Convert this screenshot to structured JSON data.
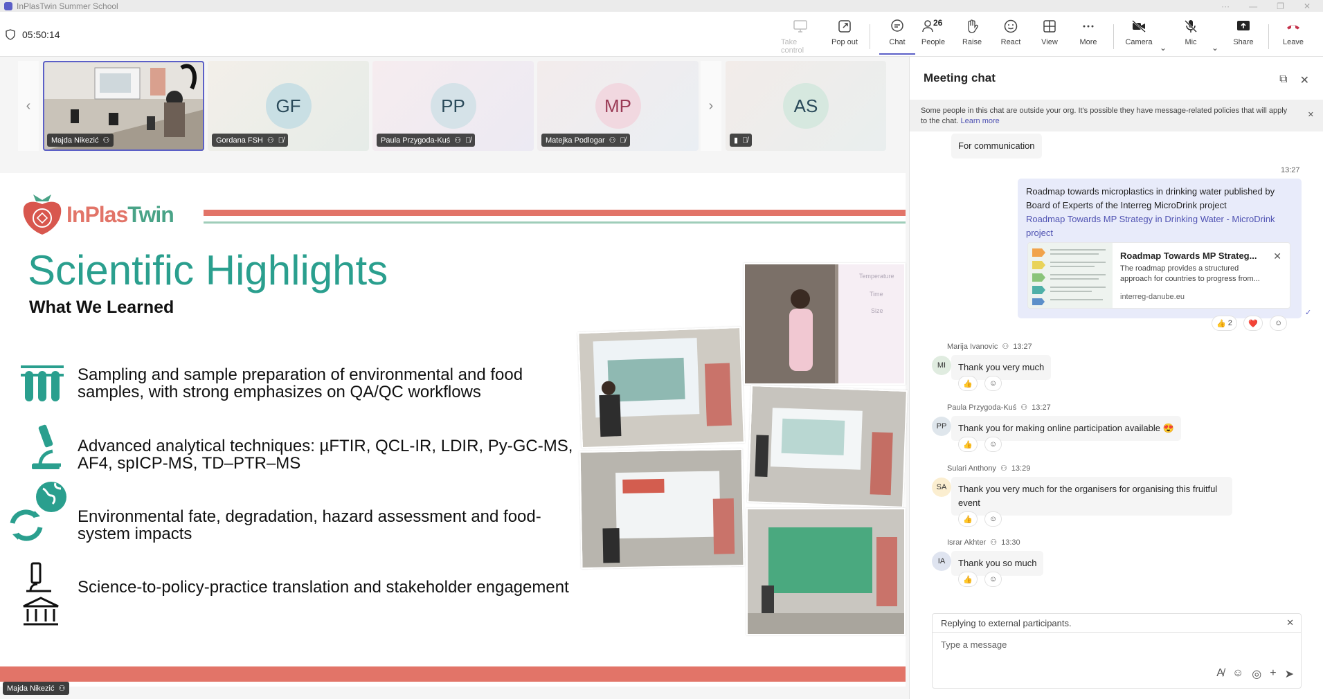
{
  "window": {
    "title": "InPlasTwin Summer School"
  },
  "toolbar": {
    "timer": "05:50:14",
    "take_control": "Take control",
    "pop_out": "Pop out",
    "chat": "Chat",
    "people": "People",
    "people_count": "26",
    "raise": "Raise",
    "react": "React",
    "view": "View",
    "more": "More",
    "camera": "Camera",
    "mic": "Mic",
    "share": "Share",
    "leave": "Leave"
  },
  "participants": [
    {
      "name": "Majda Nikezić",
      "initials": ""
    },
    {
      "name": "Gordana FSH",
      "initials": "GF"
    },
    {
      "name": "Paula Przygoda-Kuś",
      "initials": "PP"
    },
    {
      "name": "Matejka Podlogar",
      "initials": "MP"
    },
    {
      "name": "",
      "initials": "AS"
    }
  ],
  "slide": {
    "logo_a": "InPlas",
    "logo_b": "Twin",
    "title": "Scientific Highlights",
    "subtitle": "What We Learned",
    "highlights": [
      "Sampling and sample preparation of environmental and food samples, with strong emphasizes on QA/QC workflows",
      "Advanced analytical techniques: µFTIR, QCL-IR, LDIR, Py-GC-MS, AF4, spICP-MS, TD–PTR–MS",
      "Environmental fate, degradation, hazard assessment and food-system impacts",
      "Science-to-policy-practice translation and stakeholder engagement"
    ],
    "photo_labels": {
      "temperature": "Temperature",
      "time": "Time",
      "size": "Size"
    }
  },
  "presenter": "Majda Nikezić",
  "chat": {
    "title": "Meeting chat",
    "notice": "Some people in this chat are outside your org. It's possible they have message-related policies that will apply to the chat.",
    "notice_link": "Learn more",
    "messages": [
      {
        "text": "For communication"
      },
      {
        "time": "13:27",
        "text": "Roadmap towards microplastics in drinking water published by Board of Experts of the Interreg MicroDrink project",
        "link": "Roadmap Towards MP Strategy in Drinking Water - MicroDrink project",
        "preview_title": "Roadmap Towards MP Strateg...",
        "preview_desc": "The roadmap provides a structured approach for countries to progress from...",
        "preview_domain": "interreg-danube.eu",
        "like_count": "2"
      },
      {
        "sender": "Marija Ivanovic",
        "time": "13:27",
        "initials": "MI",
        "text": "Thank you very much"
      },
      {
        "sender": "Paula Przygoda-Kuś",
        "time": "13:27",
        "initials": "PP",
        "text": "Thank you for making online participation available 😍"
      },
      {
        "sender": "Sulari Anthony",
        "time": "13:29",
        "initials": "SA",
        "text": "Thank you very much for the organisers for organising this fruitful event"
      },
      {
        "sender": "Israr Akhter",
        "time": "13:30",
        "initials": "IA",
        "text": "Thank you so much"
      }
    ],
    "reply_notice": "Replying to external participants.",
    "compose_placeholder": "Type a message"
  },
  "colors": {
    "accent": "#5b5fc7",
    "brand_teal": "#2a9f8e",
    "brand_coral": "#e27468",
    "leave_red": "#c4314b"
  }
}
